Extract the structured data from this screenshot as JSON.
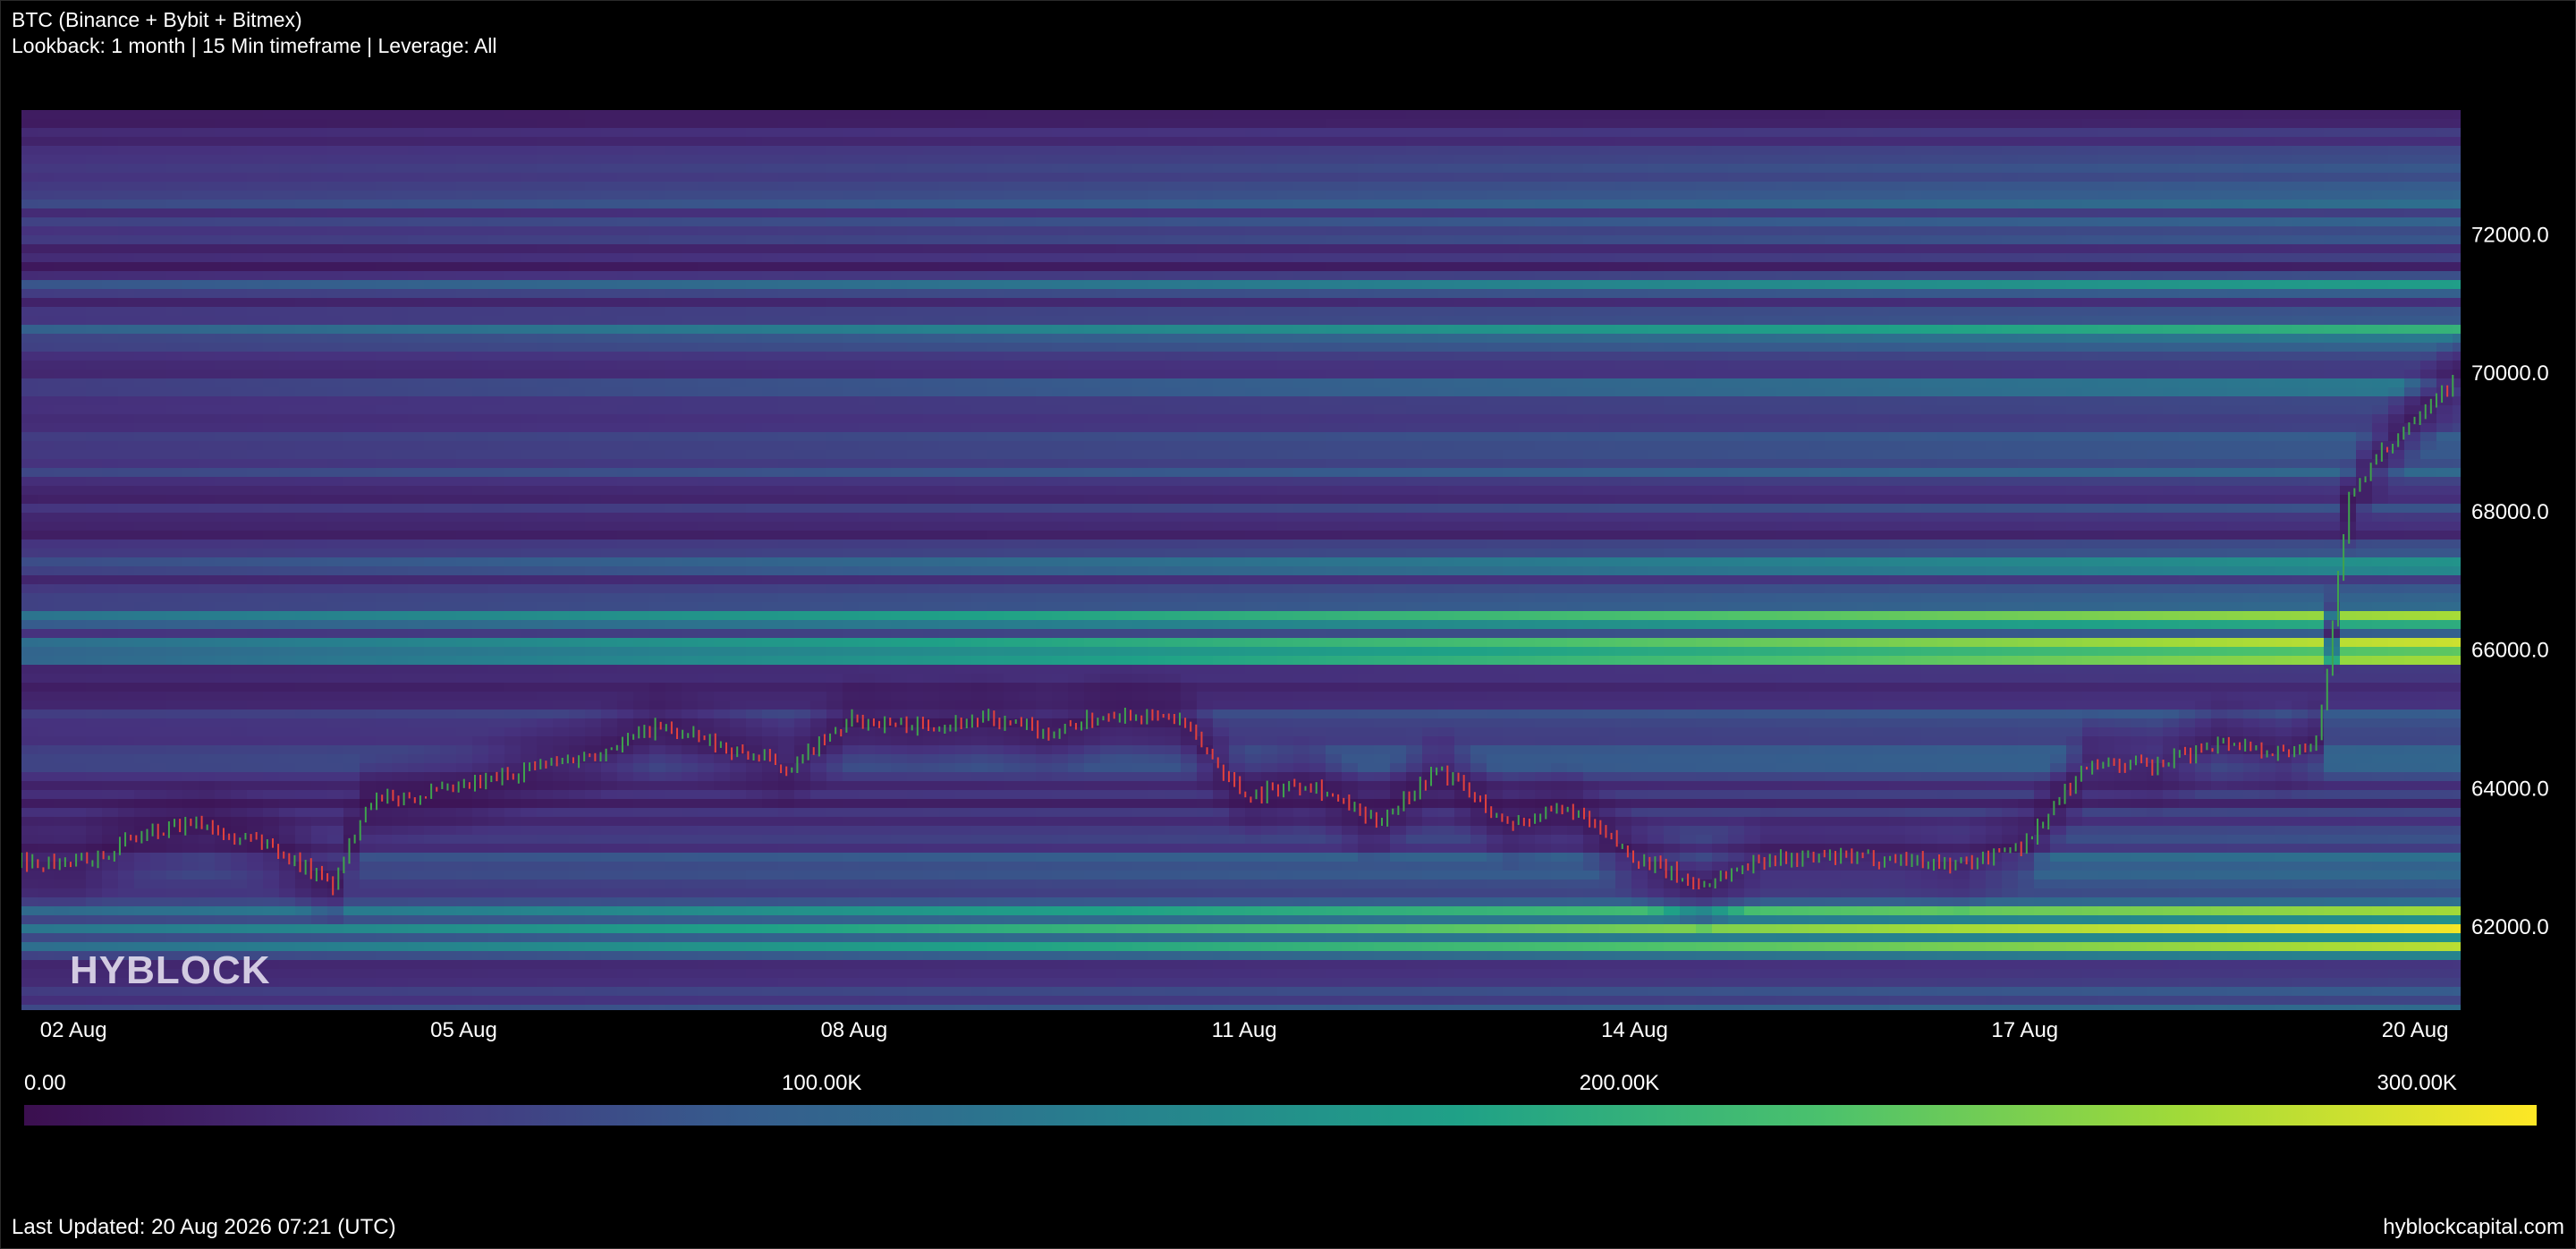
{
  "header": {
    "title": "BTC (Binance + Bybit + Bitmex)",
    "subtitle": "Lookback: 1 month | 15 Min timeframe | Leverage: All"
  },
  "watermark": "HYBLOCK",
  "colorbar": {
    "labels": [
      "0.00",
      "100.00K",
      "200.00K",
      "300.00K"
    ],
    "range": [
      0,
      315000
    ],
    "colors": [
      "#3b0f4f",
      "#46327e",
      "#365c8d",
      "#277f8e",
      "#1fa187",
      "#4ac16d",
      "#a0da39",
      "#fde725"
    ]
  },
  "footer": {
    "last_updated": "Last Updated: 20 Aug 2026 07:21 (UTC)",
    "site": "hyblockcapital.com"
  },
  "colors": {
    "background": "#000000",
    "candle_up": "#3fa34d",
    "candle_down": "#e2413c"
  },
  "chart_data": {
    "type": "heatmap",
    "title": "",
    "xlabel": "",
    "ylabel": "",
    "x_start": "01 Aug",
    "x_end": "20 Aug",
    "xticks": [
      "02 Aug",
      "05 Aug",
      "08 Aug",
      "11 Aug",
      "14 Aug",
      "17 Aug",
      "20 Aug"
    ],
    "xtick_days": [
      2,
      5,
      8,
      11,
      14,
      17,
      20
    ],
    "x_range_days": [
      1.6,
      20.35
    ],
    "yticks": [
      "62000.0",
      "64000.0",
      "66000.0",
      "68000.0",
      "70000.0",
      "72000.0"
    ],
    "ytick_values": [
      62000,
      64000,
      66000,
      68000,
      70000,
      72000
    ],
    "ylim": [
      60800,
      73800
    ],
    "liquidation_levels": [
      {
        "price": 61700,
        "value": 230000
      },
      {
        "price": 61950,
        "value": 270000
      },
      {
        "price": 62200,
        "value": 240000
      },
      {
        "price": 65900,
        "value": 300000
      },
      {
        "price": 66100,
        "value": 260000
      },
      {
        "price": 66450,
        "value": 210000
      },
      {
        "price": 67200,
        "value": 140000
      },
      {
        "price": 69800,
        "value": 120000
      },
      {
        "price": 70600,
        "value": 110000
      },
      {
        "price": 71300,
        "value": 100000
      }
    ],
    "price_series": {
      "name": "",
      "points": [
        [
          "01 Aug",
          63000
        ],
        [
          "02 Aug",
          62900
        ],
        [
          "02 Aug 12:00",
          63300
        ],
        [
          "03 Aug",
          63500
        ],
        [
          "03 Aug 12:00",
          63200
        ],
        [
          "04 Aug",
          62600
        ],
        [
          "04 Aug 06:00",
          63800
        ],
        [
          "05 Aug",
          64000
        ],
        [
          "05 Aug 12:00",
          64300
        ],
        [
          "06 Aug",
          64500
        ],
        [
          "06 Aug 12:00",
          64900
        ],
        [
          "07 Aug",
          64600
        ],
        [
          "07 Aug 12:00",
          64300
        ],
        [
          "08 Aug",
          65000
        ],
        [
          "08 Aug 12:00",
          64900
        ],
        [
          "09 Aug",
          65000
        ],
        [
          "09 Aug 12:00",
          64800
        ],
        [
          "10 Aug",
          65100
        ],
        [
          "10 Aug 12:00",
          65000
        ],
        [
          "11 Aug",
          63900
        ],
        [
          "11 Aug 12:00",
          64100
        ],
        [
          "12 Aug",
          63500
        ],
        [
          "12 Aug 12:00",
          64300
        ],
        [
          "13 Aug",
          63500
        ],
        [
          "13 Aug 12:00",
          63700
        ],
        [
          "14 Aug",
          63000
        ],
        [
          "14 Aug 12:00",
          62600
        ],
        [
          "15 Aug",
          63000
        ],
        [
          "16 Aug",
          63000
        ],
        [
          "16 Aug 12:00",
          62900
        ],
        [
          "17 Aug",
          63200
        ],
        [
          "17 Aug 12:00",
          64400
        ],
        [
          "18 Aug",
          64300
        ],
        [
          "18 Aug 12:00",
          64700
        ],
        [
          "19 Aug",
          64500
        ],
        [
          "19 Aug 06:00",
          64700
        ],
        [
          "19 Aug 12:00",
          68300
        ],
        [
          "20 Aug",
          69400
        ],
        [
          "20 Aug 07:00",
          69900
        ]
      ]
    }
  }
}
